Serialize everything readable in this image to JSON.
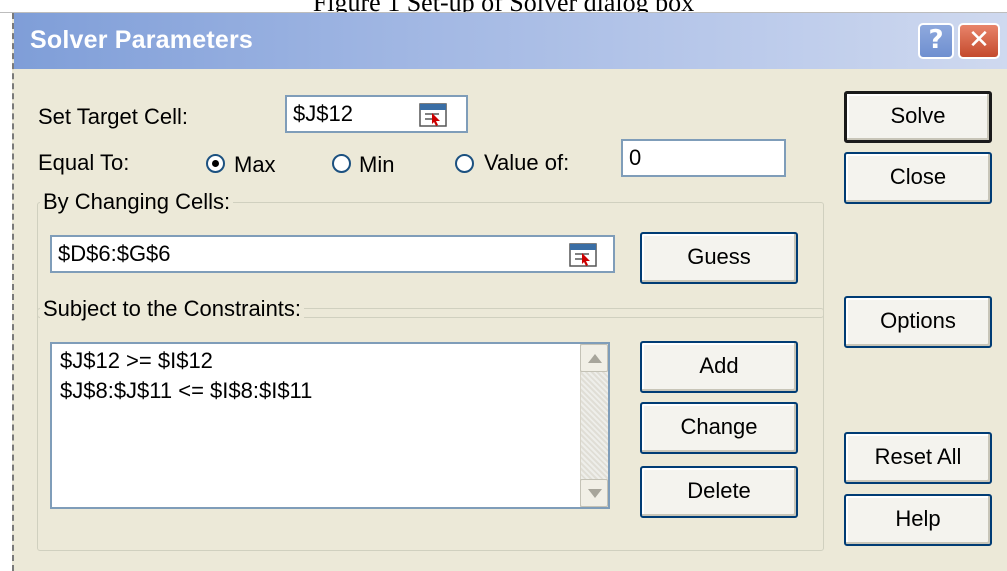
{
  "caption": "Figure 1 Set-up of Solver dialog box",
  "window": {
    "title": "Solver Parameters",
    "help_glyph": "?",
    "close_glyph": "✕"
  },
  "target": {
    "label": "Set Target Cell:",
    "value": "$J$12"
  },
  "equal_to": {
    "label": "Equal To:",
    "options": [
      {
        "label": "Max",
        "selected": true
      },
      {
        "label": "Min",
        "selected": false
      },
      {
        "label": "Value of:",
        "selected": false
      }
    ],
    "value_of": "0"
  },
  "changing": {
    "group_label": "By Changing Cells:",
    "value": "$D$6:$G$6",
    "guess_label": "Guess"
  },
  "constraints": {
    "group_label": "Subject to the Constraints:",
    "items": [
      "$J$12 >= $I$12",
      "$J$8:$J$11 <= $I$8:$I$11"
    ],
    "add_label": "Add",
    "change_label": "Change",
    "delete_label": "Delete"
  },
  "side_buttons": {
    "solve": "Solve",
    "close": "Close",
    "options": "Options",
    "reset_all": "Reset All",
    "help": "Help"
  },
  "icons": {
    "ref": "range-selector-icon",
    "scroll_up": "chevron-up-icon",
    "scroll_down": "chevron-down-icon"
  }
}
